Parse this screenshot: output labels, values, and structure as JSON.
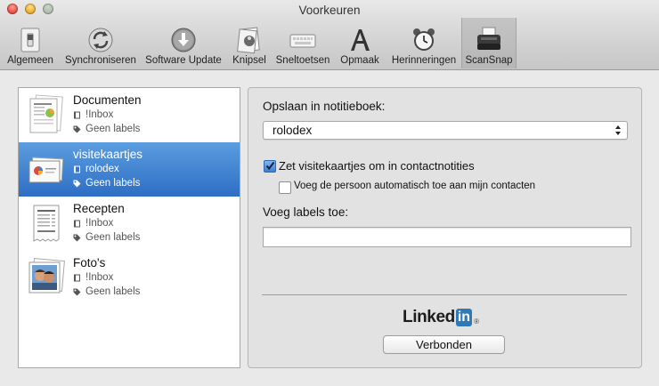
{
  "window": {
    "title": "Voorkeuren"
  },
  "toolbar": {
    "items": [
      {
        "label": "Algemeen",
        "icon": "switch-icon"
      },
      {
        "label": "Synchroniseren",
        "icon": "sync-icon"
      },
      {
        "label": "Software Update",
        "icon": "download-icon"
      },
      {
        "label": "Knipsel",
        "icon": "clipper-icon"
      },
      {
        "label": "Sneltoetsen",
        "icon": "keyboard-icon"
      },
      {
        "label": "Opmaak",
        "icon": "font-icon"
      },
      {
        "label": "Herinneringen",
        "icon": "alarm-clock-icon"
      },
      {
        "label": "ScanSnap",
        "icon": "scanner-icon",
        "selected": true
      }
    ]
  },
  "profiles": [
    {
      "name": "Documenten",
      "notebook": "!Inbox",
      "labels": "Geen labels",
      "thumb": "document-thumbnail"
    },
    {
      "name": "visitekaartjes",
      "notebook": "rolodex",
      "labels": "Geen labels",
      "thumb": "business-card-thumbnail",
      "selected": true
    },
    {
      "name": "Recepten",
      "notebook": "!Inbox",
      "labels": "Geen labels",
      "thumb": "receipt-thumbnail"
    },
    {
      "name": "Foto's",
      "notebook": "!Inbox",
      "labels": "Geen labels",
      "thumb": "photo-thumbnail"
    }
  ],
  "settings": {
    "notebook_label": "Opslaan in notitieboek:",
    "notebook_value": "rolodex",
    "contact_checkbox_label": "Zet visitekaartjes om in contactnotities",
    "contact_checked": true,
    "add_contact_checkbox_label": "Voeg de persoon automatisch toe aan mijn contacten",
    "add_contact_checked": false,
    "labels_label": "Voeg labels toe:",
    "labels_value": ""
  },
  "linkedin": {
    "word": "Linked",
    "box": "in",
    "mark": "®",
    "button_label": "Verbonden"
  },
  "colors": {
    "selection": "#3a7bd0",
    "linkedin_blue": "#2f79b6"
  }
}
